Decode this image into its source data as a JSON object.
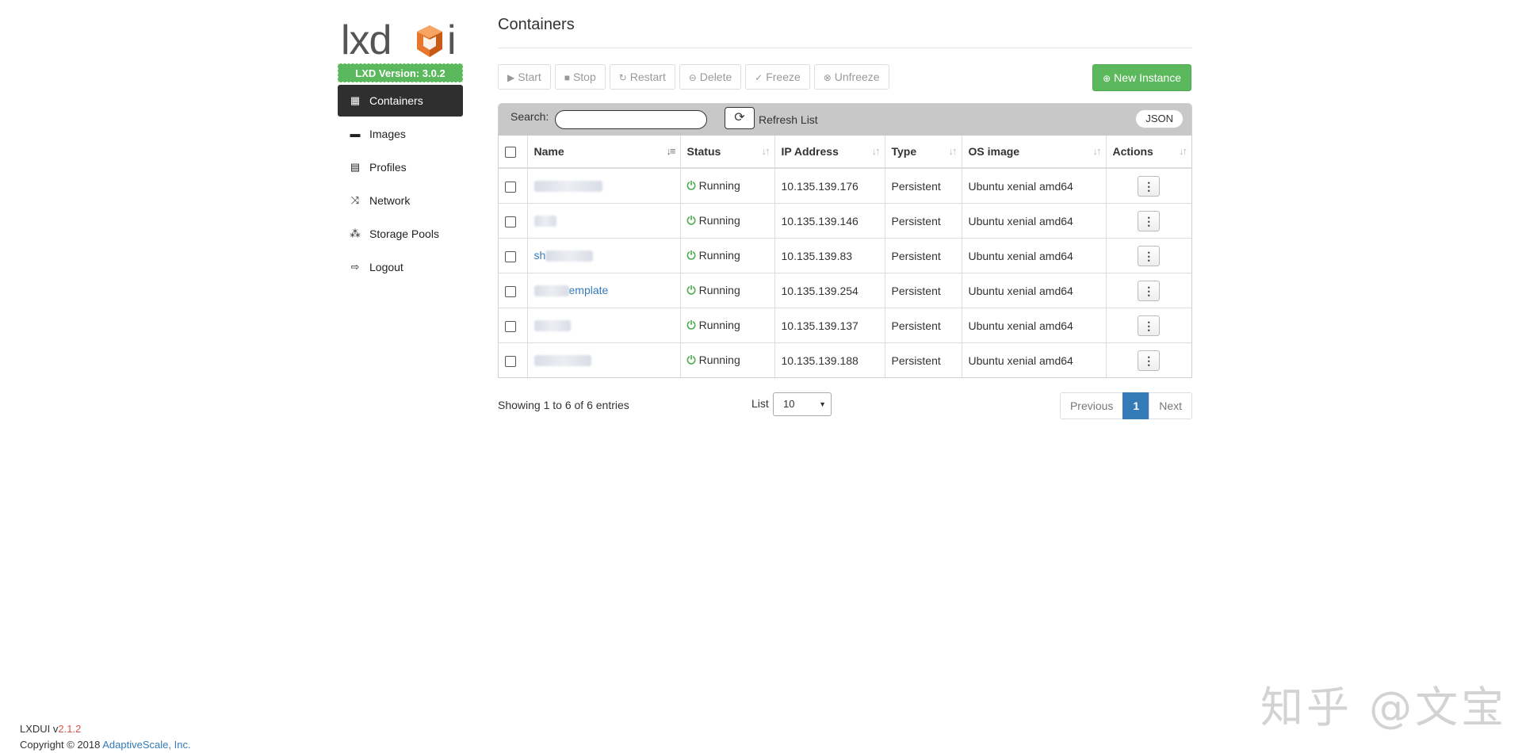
{
  "sidebar": {
    "logo_text": "lxdui",
    "version_badge": "LXD Version: 3.0.2",
    "items": [
      {
        "label": "Containers",
        "icon": "grid-icon",
        "active": true
      },
      {
        "label": "Images",
        "icon": "drive-icon"
      },
      {
        "label": "Profiles",
        "icon": "list-icon"
      },
      {
        "label": "Network",
        "icon": "shuffle-icon"
      },
      {
        "label": "Storage Pools",
        "icon": "tree-icon"
      },
      {
        "label": "Logout",
        "icon": "logout-icon"
      }
    ]
  },
  "main": {
    "title": "Containers",
    "toolbar": {
      "start": "Start",
      "stop": "Stop",
      "restart": "Restart",
      "delete": "Delete",
      "freeze": "Freeze",
      "unfreeze": "Unfreeze",
      "new_instance": "New Instance"
    },
    "search": {
      "label": "Search:",
      "value": ""
    },
    "refresh_label": "Refresh List",
    "json_button": "JSON",
    "columns": [
      "Name",
      "Status",
      "IP Address",
      "Type",
      "OS image",
      "Actions"
    ],
    "rows": [
      {
        "name": "",
        "status": "Running",
        "ip": "10.135.139.176",
        "type": "Persistent",
        "os": "Ubuntu xenial amd64"
      },
      {
        "name": "",
        "status": "Running",
        "ip": "10.135.139.146",
        "type": "Persistent",
        "os": "Ubuntu xenial amd64"
      },
      {
        "name": "sh",
        "status": "Running",
        "ip": "10.135.139.83",
        "type": "Persistent",
        "os": "Ubuntu xenial amd64"
      },
      {
        "name": "emplate",
        "status": "Running",
        "ip": "10.135.139.254",
        "type": "Persistent",
        "os": "Ubuntu xenial amd64"
      },
      {
        "name": "",
        "status": "Running",
        "ip": "10.135.139.137",
        "type": "Persistent",
        "os": "Ubuntu xenial amd64"
      },
      {
        "name": "",
        "status": "Running",
        "ip": "10.135.139.188",
        "type": "Persistent",
        "os": "Ubuntu xenial amd64"
      }
    ],
    "showing": "Showing 1 to 6 of 6 entries",
    "list_label": "List",
    "page_size": "10",
    "pagination": {
      "previous": "Previous",
      "current": "1",
      "next": "Next"
    }
  },
  "footer": {
    "app_name": "LXDUI v",
    "app_version": "2.1.2",
    "copyright": "Copyright © 2018 ",
    "company": "AdaptiveScale, Inc."
  },
  "watermark": "知乎 @文宝",
  "colors": {
    "accent_green": "#5cb85c",
    "link_blue": "#337ab7",
    "active_nav": "#2f2f2f",
    "logo_orange": "#e8772e"
  }
}
